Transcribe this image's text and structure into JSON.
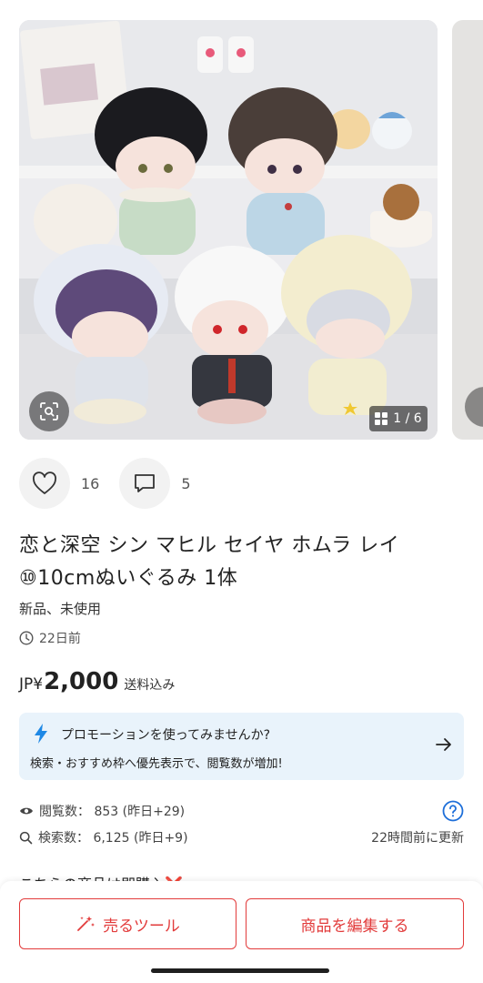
{
  "gallery": {
    "counter": "1 / 6",
    "counter_color": "#ffffff"
  },
  "reactions": {
    "likes": "16",
    "comments": "5"
  },
  "item": {
    "title": "恋と深空 シン マヒル セイヤ ホムラ レイ ⑩10cmぬいぐるみ 1体",
    "condition": "新品、未使用",
    "posted": "22日前"
  },
  "price": {
    "currency": "JP¥",
    "amount": "2,000",
    "shipping": "送料込み"
  },
  "promo": {
    "title": "プロモーションを使ってみませんか?",
    "description": "検索・おすすめ枠へ優先表示で、閲覧数が増加!",
    "accent": "#1e88e5",
    "background": "#e9f3fb"
  },
  "stats": {
    "views": "閲覧数： 853 (昨日+29)",
    "searches": "検索数： 6,125 (昨日+9)",
    "updated": "22時間前に更新"
  },
  "clipped_section": {
    "text": "こちらの商品は即購入"
  },
  "actions": {
    "sell_tool": "売るツール",
    "edit_item": "商品を編集する",
    "accent": "#e23b3b"
  }
}
